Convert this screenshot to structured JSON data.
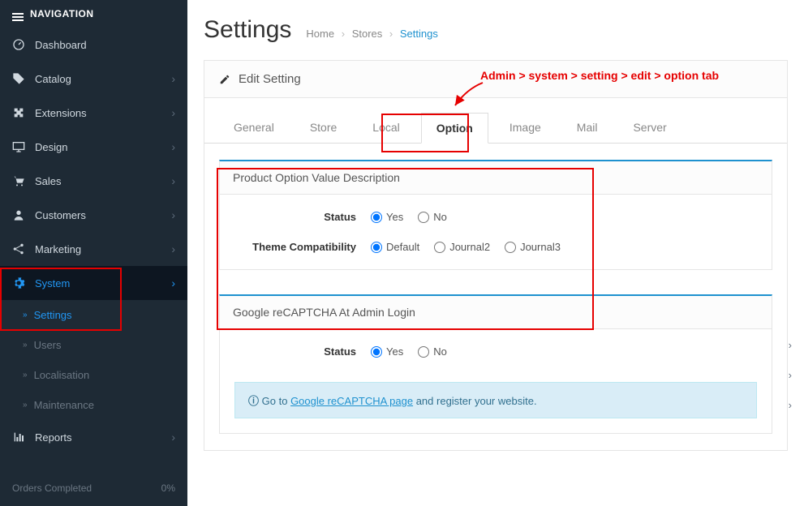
{
  "nav": {
    "header": "NAVIGATION",
    "items": {
      "dashboard": "Dashboard",
      "catalog": "Catalog",
      "extensions": "Extensions",
      "design": "Design",
      "sales": "Sales",
      "customers": "Customers",
      "marketing": "Marketing",
      "system": "System",
      "reports": "Reports"
    },
    "sub": {
      "settings": "Settings",
      "users": "Users",
      "localisation": "Localisation",
      "maintenance": "Maintenance"
    },
    "stats": {
      "orders_label": "Orders Completed",
      "orders_val": "0%"
    }
  },
  "page": {
    "title": "Settings",
    "bc": {
      "home": "Home",
      "stores": "Stores",
      "settings": "Settings"
    }
  },
  "panel": {
    "head": "Edit Setting",
    "tabs": {
      "general": "General",
      "store": "Store",
      "local": "Local",
      "option": "Option",
      "image": "Image",
      "mail": "Mail",
      "server": "Server"
    }
  },
  "sec1": {
    "title": "Product Option Value Description",
    "status_label": "Status",
    "theme_label": "Theme Compatibility",
    "yes": "Yes",
    "no": "No",
    "default": "Default",
    "j2": "Journal2",
    "j3": "Journal3"
  },
  "sec2": {
    "title": "Google reCAPTCHA At Admin Login",
    "status_label": "Status",
    "yes": "Yes",
    "no": "No",
    "info_pre": "Go to ",
    "info_link": "Google reCAPTCHA page",
    "info_post": " and register your website."
  },
  "annotation": "Admin > system > setting > edit > option tab"
}
